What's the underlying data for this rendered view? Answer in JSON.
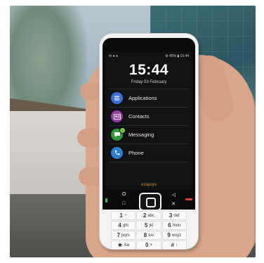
{
  "status": {
    "left": "✉ ● ●",
    "right": "⚙ 45% ▮ 15:44"
  },
  "clock": "15:44",
  "date": "Friday 03 February",
  "menu": [
    {
      "label": "Applications",
      "icon": "applications-icon",
      "color": "#3c6fd6"
    },
    {
      "label": "Contacts",
      "icon": "contacts-icon",
      "color": "#9a3aa6"
    },
    {
      "label": "Messaging",
      "icon": "messaging-icon",
      "color": "#2f9a3c",
      "badge": "1"
    },
    {
      "label": "Phone",
      "icon": "phone-icon",
      "color": "#2d7fd3"
    }
  ],
  "brand": "ezapsys",
  "nav": {
    "left_top": "O",
    "right_top": "◁",
    "left_bottom": "□",
    "right_bottom": "✕"
  },
  "keys": [
    {
      "num": "1",
      "sub": "⌣"
    },
    {
      "num": "2",
      "sub": "abc"
    },
    {
      "num": "3",
      "sub": "def"
    },
    {
      "num": "4",
      "sub": "ghi"
    },
    {
      "num": "5",
      "sub": "jkl"
    },
    {
      "num": "6",
      "sub": "mno"
    },
    {
      "num": "7",
      "sub": "pqrs"
    },
    {
      "num": "8",
      "sub": "tuv"
    },
    {
      "num": "9",
      "sub": "wxyz"
    },
    {
      "num": "★",
      "sub": "Aa"
    },
    {
      "num": "0",
      "sub": "+"
    },
    {
      "num": "#",
      "sub": "↑"
    }
  ]
}
